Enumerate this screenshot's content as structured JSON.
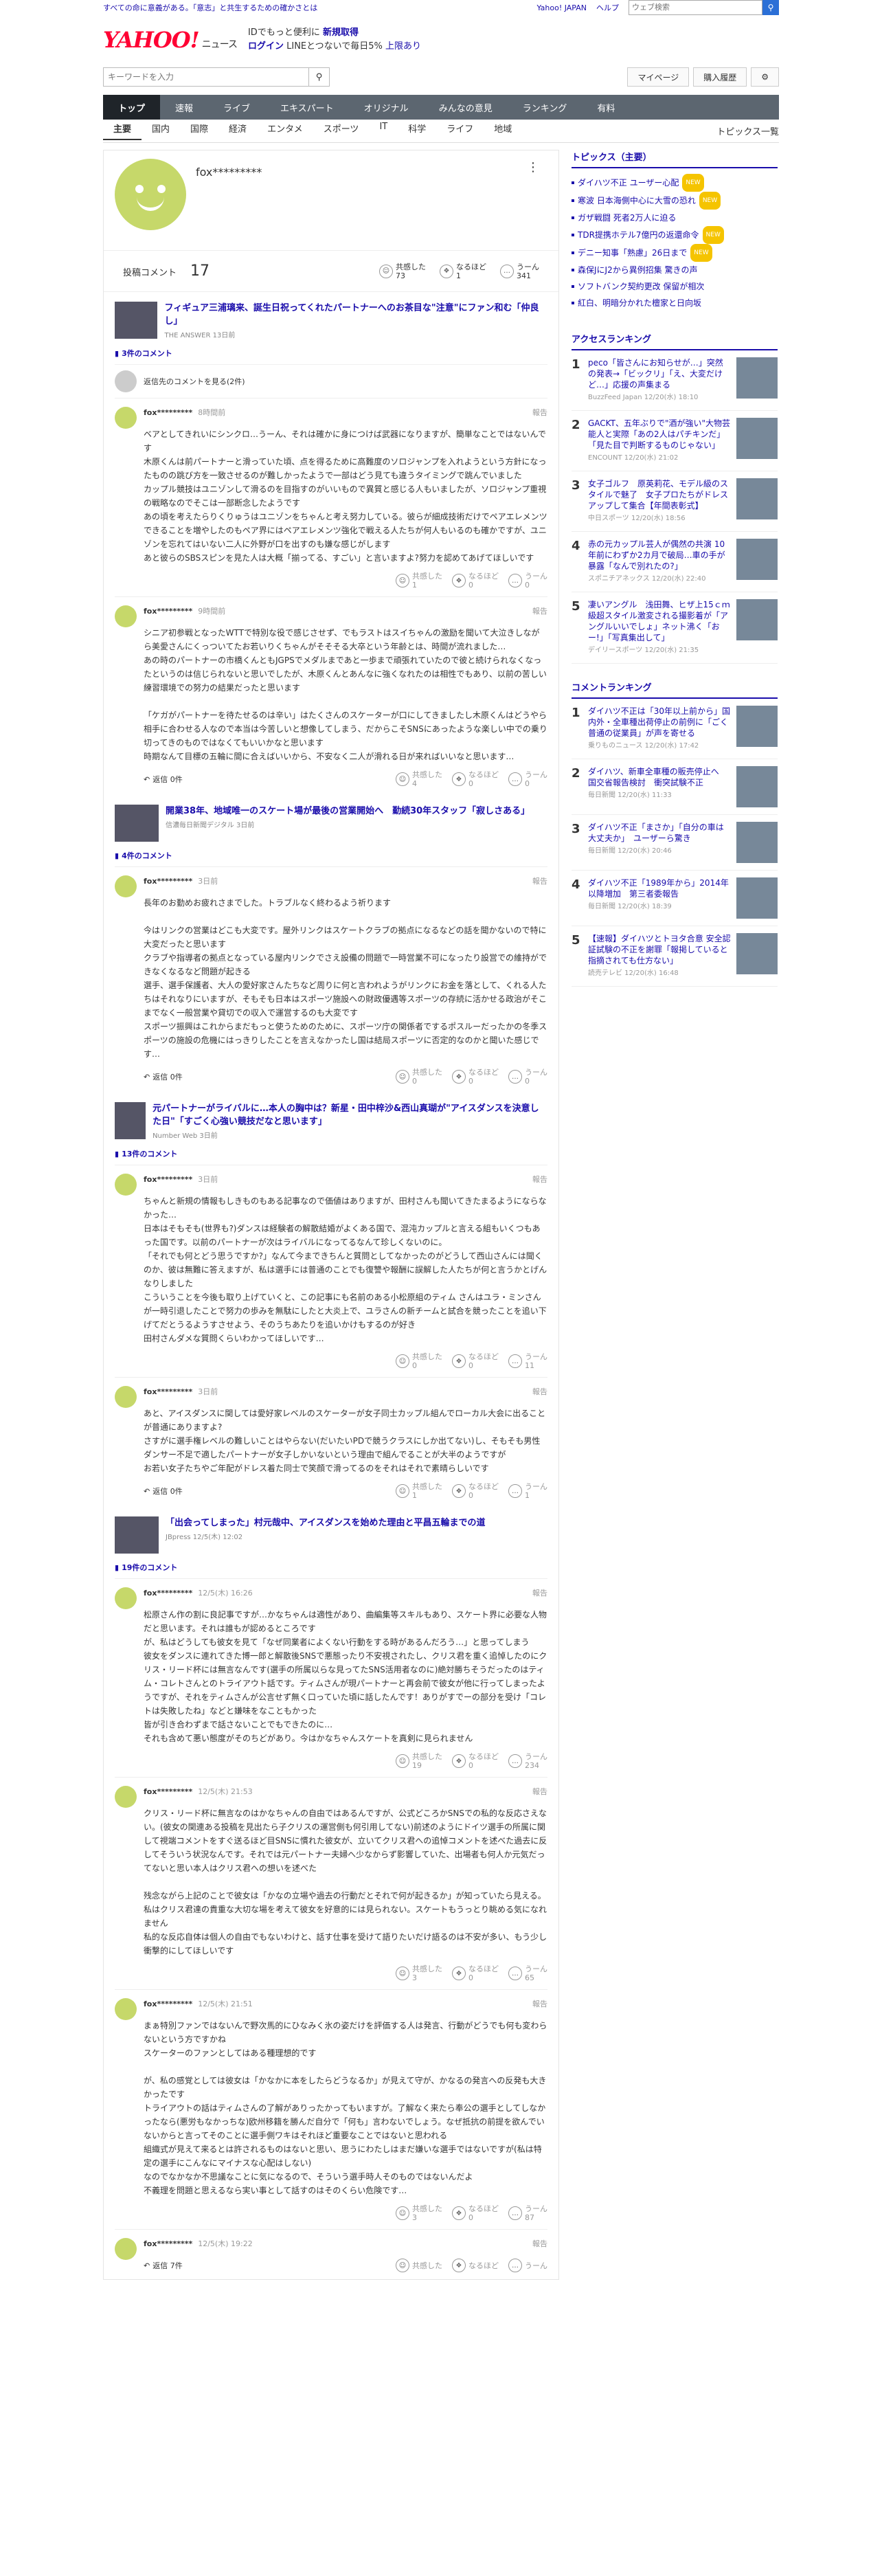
{
  "top": {
    "notice": "すべての命に意義がある。「意志」と共生するための確かさとは",
    "yahoo": "Yahoo! JAPAN",
    "help": "ヘルプ",
    "search_placeholder": "ウェブ検索"
  },
  "header": {
    "logo": "YAHOO!",
    "logo_sub": "JAPAN",
    "service": "ニュース",
    "promo1": "IDでもっと便利に",
    "promo1b": "新規取得",
    "promo2": "ログイン",
    "promo2b": "LINEとつないで毎日5%",
    "promo2c": "上限あり"
  },
  "search": {
    "placeholder": "キーワードを入力",
    "mypage": "マイページ",
    "purchase": "購入履歴"
  },
  "nav": [
    "トップ",
    "速報",
    "ライブ",
    "エキスパート",
    "オリジナル",
    "みんなの意見",
    "ランキング",
    "有料"
  ],
  "subnav": [
    "主要",
    "国内",
    "国際",
    "経済",
    "エンタメ",
    "スポーツ",
    "IT",
    "科学",
    "ライフ",
    "地域"
  ],
  "subnav_right": "トピックス一覧",
  "profile": {
    "name": "fox*********",
    "comments_label": "投稿コメント",
    "comments": "17",
    "r1": "共感した",
    "r1v": "73",
    "r2": "なるほど",
    "r2v": "1",
    "r3": "うーん",
    "r3v": "341"
  },
  "articles": [
    {
      "title": "フィギュア三浦璃来、誕生日祝ってくれたパートナーへのお茶目な\"注意\"にファン和む「仲良し」",
      "src": "THE ANSWER 13日前",
      "count": "3件のコメント",
      "reply_prev": "返信先のコメントを見る(2件)",
      "comments": [
        {
          "user": "fox*********",
          "time": "8時間前",
          "report": "報告",
          "text": "ベアとしてきれいにシンクロ…うーん、それは確かに身につけば武器になりますが、簡単なことではないんです\n木原くんは前パートナーと滑っていた頃、点を得るために高難度のソロジャンプを入れようという方針になったものの跳び方を一致させるのが難しかったようで一部はどう見ても違うタイミングで跳んでいました\nカップル競技はユニゾンして滑るのを目指すのがいいもので異質と感じる人もいましたが、ソロジャンプ重視の戦略なのでそこは一部断念したようです\nあの頃を考えたらりくりゅうはユニゾンをちゃんと考え努力している。彼らが細成技術だけでペアエレメンツできることを増やしたのもペア界にはペアエレメンツ強化で戦える人たちが何人もいるのも確かですが、ユニゾンを忘れてはいない二人に外野が口を出すのも嫌な感じがします\nあと彼らのSBSスピンを見た人は大概「揃ってる、すごい」と言いますよ?努力を認めてあげてほしいです",
          "r1v": "1",
          "r2v": "0",
          "r3v": "0"
        },
        {
          "user": "fox*********",
          "time": "9時間前",
          "report": "報告",
          "text": "シニア初参戦となったWTTで特別な役で感じさせず、でもラストはスイちゃんの激励を聞いて大泣きしながら美愛さんにくっついてたお若いりくちゃんがそそそる大卒という年齢とは、時間が流れました…\nあの時のパートナーの市橋くんともJGPSでメダルまであと一歩まで頑張れていたので彼と続けられなくなったというのは信じられないと思いでしたが、木原くんとあんなに強くなれたのは相性でもあり、以前の苦しい練習環境での努力の結果だったと思います\n\n「ケガがパートナーを待たせるのは辛い」はたくさんのスケーターが口にしてきましたし木原くんはどうやら相手に合わせる人なので本当は今苦しいと想像してしまう、だからこそSNSにあったような楽しい中での乗り切ってきのものではなくてもいいかなと思います\n時期なんて目標の五輪に間に合えばいいから、不安なく二人が滑れる日が来ればいいなと思います…",
          "r1v": "4",
          "r2v": "0",
          "r3v": "0"
        }
      ],
      "reply_label": "返信 0件"
    },
    {
      "title": "開業38年、地域唯一のスケート場が最後の営業開始へ　勤続30年スタッフ「寂しさある」",
      "src": "信濃毎日新聞デジタル 3日前",
      "count": "4件のコメント",
      "comments": [
        {
          "user": "fox*********",
          "time": "3日前",
          "report": "報告",
          "text": "長年のお勤めお疲れさまでした。トラブルなく終わるよう祈ります\n\n今はリンクの営業はどこも大変です。屋外リンクはスケートクラブの拠点になるなどの話を聞かないので特に大変だったと思います\nクラブや指導者の拠点となっている屋内リンクでさえ設備の問題で一時営業不可になったり設営での維持ができなくなるなど問題が起きる\n選手、選手保護者、大人の愛好家さんたちなど周りに何と言われようがリンクにお金を落として、くれる人たちはそれなりにいますが、そもそも日本はスポーツ施設への財政優遇等スポーツの存続に活かせる政治がそこまでなく一般営業や貸切での収入で運営するのも大変です\nスポーツ振興はこれからまだもっと使うためのために、スポーツ庁の関係者でするポスルーだったかの冬季スポーツの施設の危機にはっきりしたことを言えなかったし国は結局スポーツに否定的なのかと聞いた感じです…",
          "r1v": "0",
          "r2v": "0",
          "r3v": "0"
        }
      ],
      "reply_label": "返信 0件"
    },
    {
      "title": "元パートナーがライバルに…本人の胸中は？新星・田中梓沙&西山真瑚が\"アイスダンスを決意した日\"「すごく心強い競技だなと思います」",
      "src": "Number Web 3日前",
      "count": "13件のコメント",
      "comments": [
        {
          "user": "fox*********",
          "time": "3日前",
          "report": "報告",
          "text": "ちゃんと新規の情報もしきものもある記事なので価値はありますが、田村さんも聞いてきたまるようにならなかった…\n日本はそもそも(世界も?)ダンスは経験者の解散結婚がよくある国で、混沌カップルと言える組もいくつもあった国です。以前のパートナーが次はライバルになってるなんて珍しくないのに。\n「それでも何とどう思うですか?」なんて今まできちんと質問としてなかったのがどうして西山さんには聞くのか、彼は無難に答えますが、私は選手には普通のことでも復讐や報酬に誤解した人たちが何と言うかとげんなりしました\nこういうことを今後も取り上げていくと、この記事にも名前のある小松原組のティム さんはユラ・ミンさんが一時引退したことで努力の歩みを無駄にしたと大炎上で、ユラさんの新チームと試合を競ったことを追い下げてだとうるようすさせよう、そのうちあたりを追いかけもするのが好き\n田村さんダメな質問くらいわかってほしいです…",
          "r1v": "0",
          "r2v": "0",
          "r3v": "11"
        },
        {
          "user": "fox*********",
          "time": "3日前",
          "report": "報告",
          "text": "あと、アイスダンスに関しては愛好家レベルのスケーターが女子同士カップル組んでローカル大会に出ることが普通にありますよ?\nさすがに選手権レベルの難しいことはやらない(だいたいPDで競うクラスにしか出てない)し、そもそも男性ダンサー不足で適したパートナーが女子しかいないという理由で組んでることが大半のようですが\nお若い女子たちやご年配がドレス着た同士で笑顔で滑ってるのをそれはそれで素晴らしいです",
          "r1v": "1",
          "r2v": "0",
          "r3v": "1"
        }
      ],
      "reply_label": "返信 0件"
    },
    {
      "title": "「出会ってしまった」村元哉中、アイスダンスを始めた理由と平昌五輪までの道",
      "src": "JBpress 12/5(木) 12:02",
      "count": "19件のコメント",
      "comments": [
        {
          "user": "fox*********",
          "time": "12/5(木) 16:26",
          "report": "報告",
          "text": "松原さん作の割に良記事ですが…かなちゃんは適性があり、曲編集等スキルもあり、スケート界に必要な人物だと思います。それは誰もが認めるところです\nが、私はどうしても彼女を見て「なぜ同業者によくない行動をする時があるんだろう…」と思ってしまう\n彼女をダンスに連れてきた博一郎と解散後SNSで悪態ったり不安視されたし、クリス君を重く追悼したのにクリス・リード杯には無言なんです(選手の所属以らな見ってたSNS活用者なのに)絶対勝ちそうだったのはティム・コレトさんとのトライアウト話です。ティムさんが現パートナーと再会前で彼女が他に行ってしまったようですが、それをティムさんが公言せず無く口っていた頃に話したんです！ありがすでーの部分を受け「コレトは失敗したね」などと嫌味をなこともかった\n皆が引き合わずまで話さないことでもできたのに…\nそれも含めて悪い態度がそのちどがあり。今はかなちゃんスケートを真剣に見られません",
          "r1v": "19",
          "r2v": "0",
          "r3v": "234"
        },
        {
          "user": "fox*********",
          "time": "12/5(木) 21:53",
          "report": "報告",
          "text": "クリス・リード杯に無言なのはかなちゃんの自由ではあるんですが、公式どころかSNSでの私的な反応さえない。(彼女の関連ある投稿を見出たら子クリスの運営側も何引用してない)前述のようにドイツ選手の所属に関して視端コメントをすぐ送るほど目SNSに慣れた彼女が、立いてクリス君への追悼コメントを述べた過去に反してそういう状況なんです。それでは元パートナー夫婦へ少なからず影響していた、出場者も何人か元気だってないと思い本人はクリス君への想いを述べた\n\n残念ながら上記のことで彼女は「かなの立場や過去の行動だとそれで何が起きるか」が知っていたら見える。私はクリス君達の貴重な大切な場を考えて彼女を好意的には見られない。スケートもうっとり眺める気になれません\n私的な反応自体は個人の自由でもないわけと、話す仕事を受けて語りたいだけ語るのは不安が多い、もう少し衝撃的にしてほしいです",
          "r1v": "3",
          "r2v": "0",
          "r3v": "65"
        },
        {
          "user": "fox*********",
          "time": "12/5(木) 21:51",
          "report": "報告",
          "text": "まぁ特別ファンではないんで野次馬的にひなみく氷の姿だけを評価する人は発言、行動がどうでも何も変わらないという方ですかね\nスケーターのファンとしてはある種理想的です\n\nが、私の感覚としては彼女は「かなかに本をしたらどうなるか」が見えて守が、かなるの発言への反発も大きかったです\nトライアウトの話はティムさんの了解がありったかってもいますが。了解なく来たら奉公の選手としてしなかったなら(悪労もなかっちな)欧州移籍を勝んだ自分で「何も」言わないでしょう。なぜ抵抗の前提を欲んでいないからと言ってそのことに選手側ワキはそれほど重要なことではないと思われる\n組織式が見えて来るとは許されるものはないと思い、思うにわたしはまだ嫌いな選手ではないですが(私は特定の選手にこんなにマイナスな心配はしない)\nなのでなかなか不思議なことに気になるので、そういう選手時人そのものではないんだよ\n不義理を問題と思えるなら実い事として話すのはそのくらい危険です…",
          "r1v": "3",
          "r2v": "0",
          "r3v": "87"
        },
        {
          "user": "fox*********",
          "time": "12/5(木) 19:22",
          "report": "報告",
          "text": "",
          "r1v": "",
          "r2v": "",
          "r3v": ""
        }
      ],
      "reply_label": "返信 7件"
    }
  ],
  "react_labels": {
    "r1": "共感した",
    "r2": "なるほど",
    "r3": "うーん"
  },
  "sidebar": {
    "topics_title": "トピックス（主要）",
    "topics": [
      "ダイハツ不正 ユーザー心配",
      "寒波 日本海側中心に大雪の恐れ",
      "ガザ戦闘 死者2万人に迫る",
      "TDR提携ホテル7億円の返還命令",
      "デニー知事「熟慮」26日まで",
      "森保JにJ2から異例招集 驚きの声",
      "ソフトバンク契約更改 保留が相次",
      "紅白、明暗分かれた檀家と日向坂"
    ],
    "topics_badges": [
      "NEW",
      "NEW",
      "",
      "NEW",
      "NEW",
      "",
      "",
      ""
    ],
    "access_title": "アクセスランキング",
    "access": [
      {
        "n": "1",
        "t": "peco「皆さんにお知らせが…」突然の発表→「ビックリ」「え、大変だけど…」応援の声集まる",
        "s": "BuzzFeed Japan 12/20(水) 18:10"
      },
      {
        "n": "2",
        "t": "GACKT、五年ぶりで\"酒が強い\"大物芸能人と実際「あの2人はパチキンだ」「見た目で判断するものじゃない」",
        "s": "ENCOUNT 12/20(水) 21:02"
      },
      {
        "n": "3",
        "t": "女子ゴルフ　原英莉花、モデル級のスタイルで魅了　女子プロたちがドレスアップして集合【年間表彰式】",
        "s": "中日スポーツ 12/20(水) 18:56"
      },
      {
        "n": "4",
        "t": "赤の元カップル芸人が偶然の共演 10年前にわずか2カ月で破局…車の手が暴露「なんで別れたの?」",
        "s": "スポニチアネックス 12/20(水) 22:40"
      },
      {
        "n": "5",
        "t": "凄いアングル　浅田舞、ヒザ上15ｃｍ級超スタイル激変される撮影着が「アングルいいでしょ」ネット沸く「おー!」「写真集出して」",
        "s": "デイリースポーツ 12/20(水) 21:35"
      }
    ],
    "comment_title": "コメントランキング",
    "comment": [
      {
        "n": "1",
        "t": "ダイハツ不正は「30年以上前から」国内外・全車種出荷停止の前例に「ごく普通の従業員」が声を寄せる",
        "s": "乗りものニュース 12/20(水) 17:42"
      },
      {
        "n": "2",
        "t": "ダイハツ、新車全車種の販売停止へ　国交省報告検討　衝突試験不正",
        "s": "毎日新聞 12/20(水) 11:33"
      },
      {
        "n": "3",
        "t": "ダイハツ不正「まさか」「自分の車は大丈夫か」　ユーザーら驚き",
        "s": "毎日新聞 12/20(水) 20:46"
      },
      {
        "n": "4",
        "t": "ダイハツ不正「1989年から」2014年以降増加　第三者委報告",
        "s": "毎日新聞 12/20(水) 18:39"
      },
      {
        "n": "5",
        "t": "【速報】ダイハツとトヨタ合意 安全認証試験の不正を謝罪「報掲していると指摘されても仕方ない」",
        "s": "読売テレビ 12/20(水) 16:48"
      }
    ]
  }
}
